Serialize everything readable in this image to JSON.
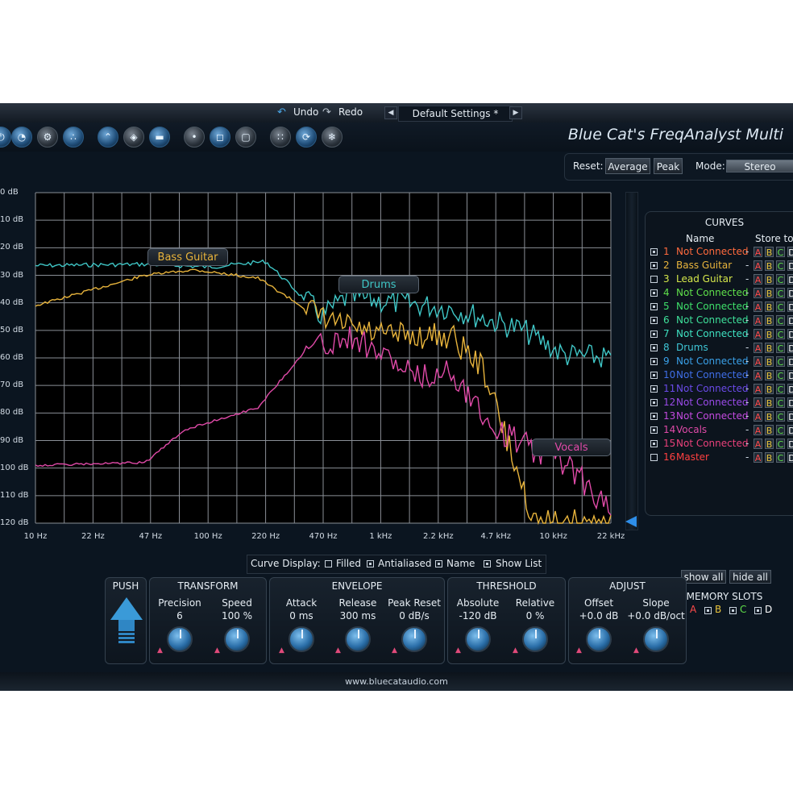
{
  "topbar": {
    "undo": "Undo",
    "redo": "Redo",
    "preset": "Default Settings *"
  },
  "app_title": "Blue Cat's FreqAnalyst Multi",
  "reset": {
    "label": "Reset:",
    "average": "Average",
    "peak": "Peak",
    "mode_label": "Mode:",
    "mode_value": "Stereo"
  },
  "graph": {
    "y_ticks": [
      "0 dB",
      "10 dB",
      "20 dB",
      "30 dB",
      "40 dB",
      "50 dB",
      "60 dB",
      "70 dB",
      "80 dB",
      "90 dB",
      "100 dB",
      "110 dB",
      "120 dB"
    ],
    "x_ticks": [
      "10 Hz",
      "22 Hz",
      "47 Hz",
      "100 Hz",
      "220 Hz",
      "470 Hz",
      "1 kHz",
      "2.2 kHz",
      "4.7 kHz",
      "10 kHz",
      "22 kHz"
    ],
    "labels": {
      "bass": "Bass Guitar",
      "drums": "Drums",
      "vocals": "Vocals"
    },
    "colors": {
      "bass": "#e8b43c",
      "drums": "#3fc6c6",
      "vocals": "#e04aa8",
      "grid": "#8a8f96"
    }
  },
  "curves": {
    "title": "CURVES",
    "name_head": "Name",
    "store_head": "Store to",
    "rows": [
      {
        "num": "1",
        "name": "Not Connected",
        "color": "#ff6a3d",
        "checked": true
      },
      {
        "num": "2",
        "name": "Bass Guitar",
        "color": "#e8b43c",
        "checked": true
      },
      {
        "num": "3",
        "name": "Lead Guitar",
        "color": "#d6e84a",
        "checked": false
      },
      {
        "num": "4",
        "name": "Not Connected",
        "color": "#5fe04a",
        "checked": true
      },
      {
        "num": "5",
        "name": "Not Connected",
        "color": "#3ee06a",
        "checked": true
      },
      {
        "num": "6",
        "name": "Not Connected",
        "color": "#3ee09a",
        "checked": true
      },
      {
        "num": "7",
        "name": "Not Connected",
        "color": "#3ee0c0",
        "checked": true
      },
      {
        "num": "8",
        "name": "Drums",
        "color": "#3fc6d6",
        "checked": true
      },
      {
        "num": "9",
        "name": "Not Connected",
        "color": "#3aa0e8",
        "checked": true
      },
      {
        "num": "10",
        "name": "Not Connected",
        "color": "#3f6ee8",
        "checked": true
      },
      {
        "num": "11",
        "name": "Not Connected",
        "color": "#6a4ae8",
        "checked": true
      },
      {
        "num": "12",
        "name": "Not Connected",
        "color": "#9a4ae8",
        "checked": true
      },
      {
        "num": "13",
        "name": "Not Connected",
        "color": "#c44ae0",
        "checked": true
      },
      {
        "num": "14",
        "name": "Vocals",
        "color": "#e04aa8",
        "checked": true
      },
      {
        "num": "15",
        "name": "Not Connected",
        "color": "#e8407a",
        "checked": true
      },
      {
        "num": "16",
        "name": "Master",
        "color": "#ff4040",
        "checked": false
      }
    ],
    "dash": "-",
    "slot_letters": [
      "A",
      "B",
      "C",
      "D"
    ],
    "show_all": "show all",
    "hide_all": "hide all",
    "memory_title": "MEMORY SLOTS",
    "memory": [
      {
        "letter": "A",
        "color": "#ff4a4a"
      },
      {
        "letter": "B",
        "color": "#e8c43c"
      },
      {
        "letter": "C",
        "color": "#5fe04a"
      },
      {
        "letter": "D",
        "color": "#ffffff"
      }
    ]
  },
  "curve_display": {
    "label": "Curve Display:",
    "filled": "Filled",
    "antialiased": "Antialiased",
    "name": "Name",
    "show_list": "Show List"
  },
  "push": {
    "title": "PUSH"
  },
  "transform": {
    "title": "TRANSFORM",
    "precision_label": "Precision",
    "precision_value": "6",
    "speed_label": "Speed",
    "speed_value": "100 %"
  },
  "envelope": {
    "title": "ENVELOPE",
    "attack_label": "Attack",
    "attack_value": "0 ms",
    "release_label": "Release",
    "release_value": "300 ms",
    "peak_reset_label": "Peak Reset",
    "peak_reset_value": "0 dB/s"
  },
  "threshold": {
    "title": "THRESHOLD",
    "absolute_label": "Absolute",
    "absolute_value": "-120 dB",
    "relative_label": "Relative",
    "relative_value": "0 %"
  },
  "adjust": {
    "title": "ADJUST",
    "offset_label": "Offset",
    "offset_value": "+0.0 dB",
    "slope_label": "Slope",
    "slope_value": "+0.0 dB/oct"
  },
  "footer": {
    "url": "www.bluecataudio.com"
  }
}
